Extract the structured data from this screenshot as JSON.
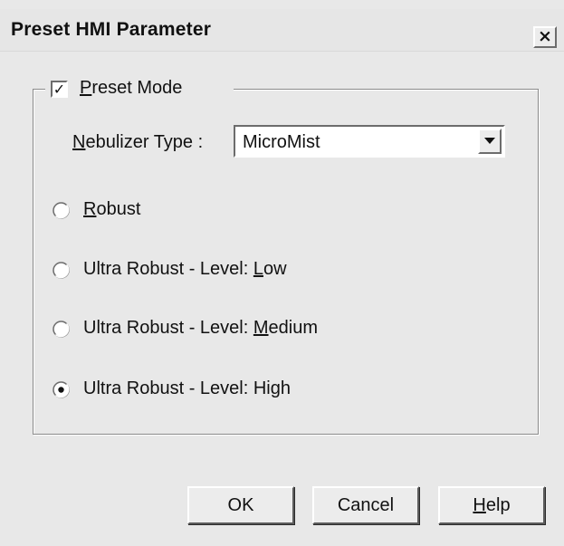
{
  "dialog": {
    "title": "Preset HMI Parameter",
    "close_glyph": "×"
  },
  "preset_mode": {
    "label_underlined": "P",
    "label_rest": "reset Mode",
    "checked": true
  },
  "nebulizer": {
    "label_underlined": "N",
    "label_rest": "ebulizer Type :",
    "value": "MicroMist"
  },
  "radios": [
    {
      "pre": "",
      "u": "R",
      "post": "obust",
      "selected": false
    },
    {
      "pre": "Ultra Robust - Level: ",
      "u": "L",
      "post": "ow",
      "selected": false
    },
    {
      "pre": "Ultra Robust - Level: ",
      "u": "M",
      "post": "edium",
      "selected": false
    },
    {
      "pre": "Ultra Robust - Level: Hi",
      "u": "g",
      "post": "h",
      "selected": true
    }
  ],
  "buttons": {
    "ok": "OK",
    "cancel": "Cancel",
    "help_underlined": "H",
    "help_rest": "elp"
  },
  "icons": {
    "close": "close-icon",
    "check": "checkmark-icon",
    "dropdown": "chevron-down-icon",
    "radio": "radio-icon"
  }
}
